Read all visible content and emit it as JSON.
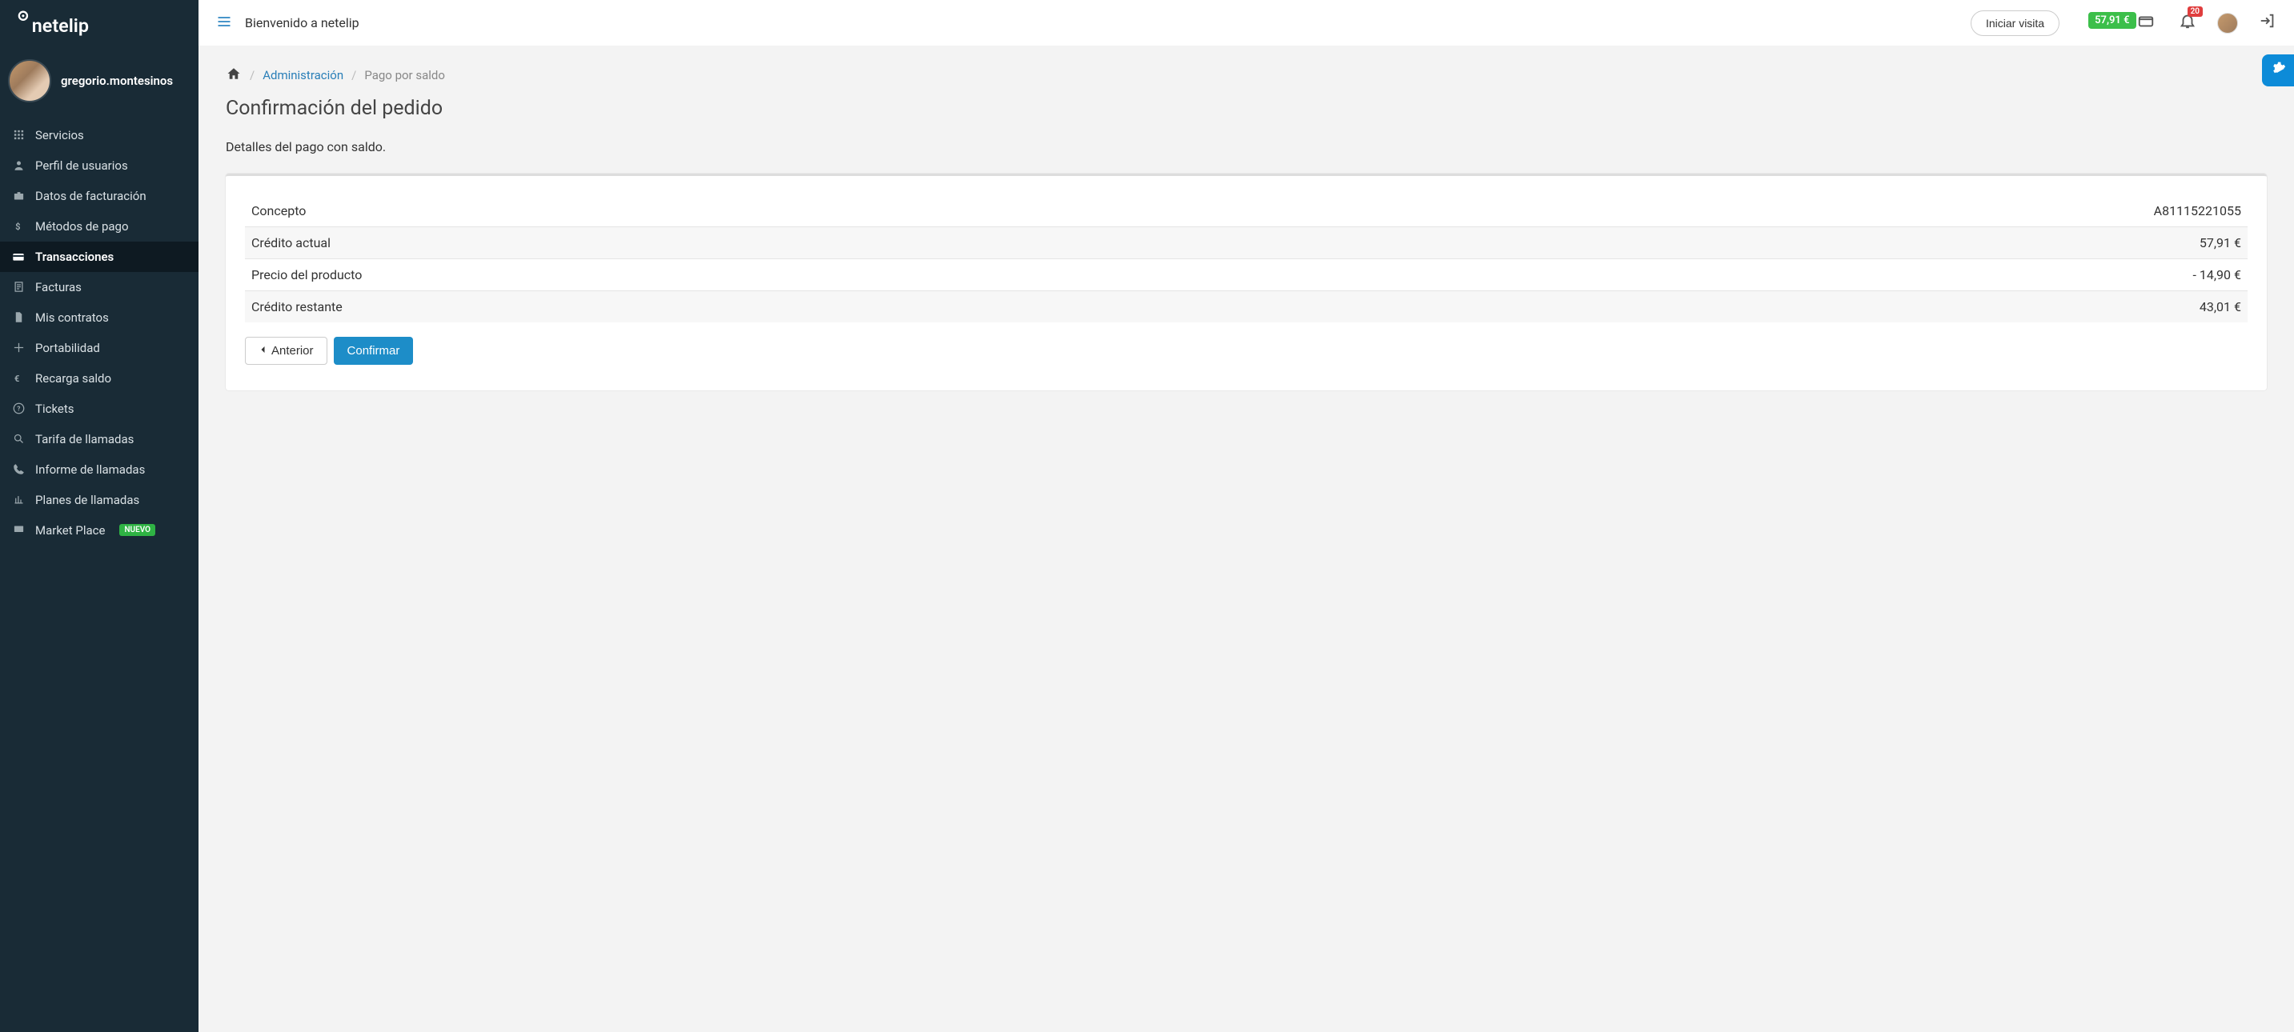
{
  "brand": "netelip",
  "user": {
    "name": "gregorio.montesinos"
  },
  "sidebar": {
    "items": [
      {
        "label": "Servicios",
        "icon": "grid"
      },
      {
        "label": "Perfil de usuarios",
        "icon": "user"
      },
      {
        "label": "Datos de facturación",
        "icon": "briefcase"
      },
      {
        "label": "Métodos de pago",
        "icon": "dollar"
      },
      {
        "label": "Transacciones",
        "icon": "card",
        "active": true
      },
      {
        "label": "Facturas",
        "icon": "sheet"
      },
      {
        "label": "Mis contratos",
        "icon": "file"
      },
      {
        "label": "Portabilidad",
        "icon": "plus"
      },
      {
        "label": "Recarga saldo",
        "icon": "euro"
      },
      {
        "label": "Tickets",
        "icon": "help"
      },
      {
        "label": "Tarifa de llamadas",
        "icon": "search"
      },
      {
        "label": "Informe de llamadas",
        "icon": "phone"
      },
      {
        "label": "Planes de llamadas",
        "icon": "plan"
      },
      {
        "label": "Market Place",
        "icon": "monitor",
        "badge": "NUEVO"
      }
    ]
  },
  "topbar": {
    "title": "Bienvenido a netelip",
    "visit_button": "Iniciar visita",
    "balance": "57,91 €",
    "notifications": "20"
  },
  "breadcrumb": {
    "home_icon": "home",
    "admin": "Administración",
    "current": "Pago por saldo"
  },
  "page": {
    "title": "Confirmación del pedido",
    "subtitle": "Detalles del pago con saldo.",
    "rows": [
      {
        "label": "Concepto",
        "value": "A81115221055"
      },
      {
        "label": "Crédito actual",
        "value": "57,91 €"
      },
      {
        "label": "Precio del producto",
        "value": "- 14,90 €"
      },
      {
        "label": "Crédito restante",
        "value": "43,01 €"
      }
    ],
    "prev_button": "Anterior",
    "confirm_button": "Confirmar"
  }
}
